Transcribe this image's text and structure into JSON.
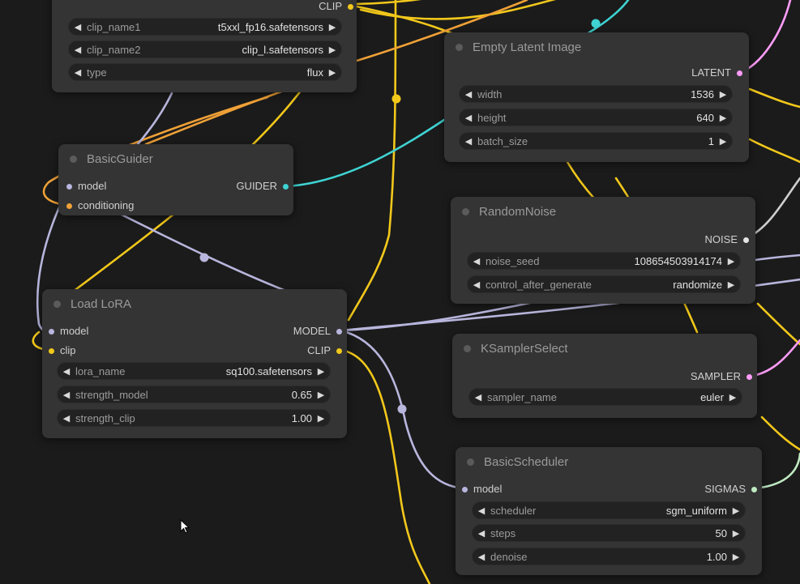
{
  "colors": {
    "background": "#1b1b1b",
    "node": "#343434",
    "clip_wire": "#f2c81b",
    "conditioning_wire": "#f0a137",
    "model_wire": "#b8b6dd",
    "guider_wire": "#3fd3d3",
    "latent_wire": "#ff9cf9",
    "sigmas_wire": "#bfeac2"
  },
  "nodes": {
    "dual_clip": {
      "output_clip": "CLIP",
      "widgets": [
        {
          "name": "clip_name1",
          "value": "t5xxl_fp16.safetensors"
        },
        {
          "name": "clip_name2",
          "value": "clip_l.safetensors"
        },
        {
          "name": "type",
          "value": "flux"
        }
      ]
    },
    "empty_latent": {
      "title": "Empty Latent Image",
      "output": "LATENT",
      "widgets": [
        {
          "name": "width",
          "value": "1536"
        },
        {
          "name": "height",
          "value": "640"
        },
        {
          "name": "batch_size",
          "value": "1"
        }
      ]
    },
    "basic_guider": {
      "title": "BasicGuider",
      "inputs": [
        "model",
        "conditioning"
      ],
      "output": "GUIDER"
    },
    "random_noise": {
      "title": "RandomNoise",
      "output": "NOISE",
      "widgets": [
        {
          "name": "noise_seed",
          "value": "108654503914174"
        },
        {
          "name": "control_after_generate",
          "value": "randomize"
        }
      ]
    },
    "load_lora": {
      "title": "Load LoRA",
      "inputs": [
        "model",
        "clip"
      ],
      "outputs": [
        "MODEL",
        "CLIP"
      ],
      "widgets": [
        {
          "name": "lora_name",
          "value": "sq100.safetensors"
        },
        {
          "name": "strength_model",
          "value": "0.65"
        },
        {
          "name": "strength_clip",
          "value": "1.00"
        }
      ]
    },
    "ksampler_select": {
      "title": "KSamplerSelect",
      "output": "SAMPLER",
      "widgets": [
        {
          "name": "sampler_name",
          "value": "euler"
        }
      ]
    },
    "basic_scheduler": {
      "title": "BasicScheduler",
      "input": "model",
      "output": "SIGMAS",
      "widgets": [
        {
          "name": "scheduler",
          "value": "sgm_uniform"
        },
        {
          "name": "steps",
          "value": "50"
        },
        {
          "name": "denoise",
          "value": "1.00"
        }
      ]
    }
  },
  "icons": {
    "widget_decrement": "◀",
    "widget_increment": "▶",
    "mouse_cursor": "cursor-arrow-icon"
  }
}
